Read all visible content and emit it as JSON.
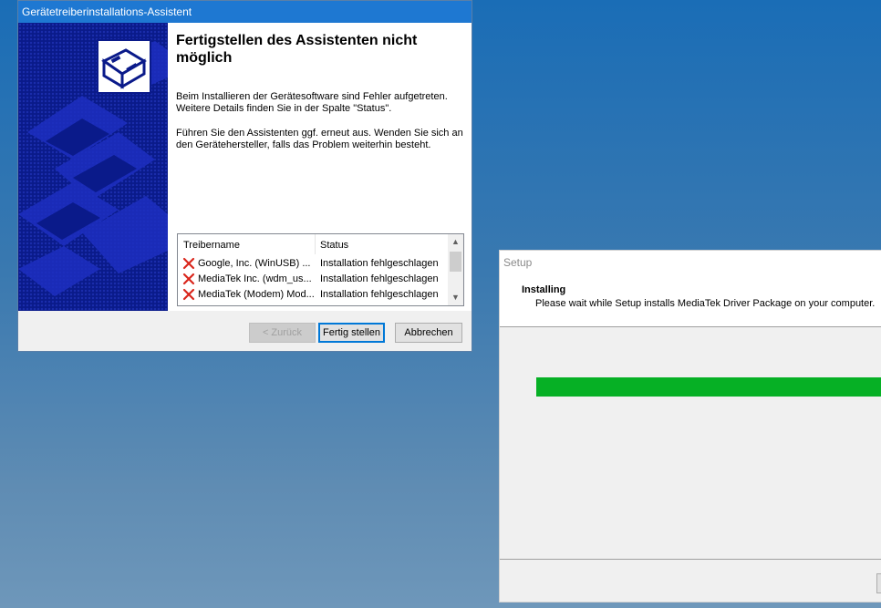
{
  "wizard": {
    "title": "Gerätetreiberinstallations-Assistent",
    "heading": "Fertigstellen des Assistenten nicht möglich",
    "paragraph1": "Beim Installieren der Gerätesoftware sind Fehler aufgetreten. Weitere Details finden Sie in der Spalte \"Status\".",
    "paragraph2": "Führen Sie den Assistenten ggf. erneut aus. Wenden Sie sich an den Gerätehersteller, falls das Problem weiterhin besteht.",
    "list": {
      "columns": [
        "Treibername",
        "Status"
      ],
      "rows": [
        {
          "name": "Google, Inc. (WinUSB) ...",
          "status": "Installation fehlgeschlagen"
        },
        {
          "name": "MediaTek Inc. (wdm_us...",
          "status": "Installation fehlgeschlagen"
        },
        {
          "name": "MediaTek (Modem) Mod...",
          "status": "Installation fehlgeschlagen"
        }
      ]
    },
    "buttons": {
      "back": "< Zurück",
      "finish": "Fertig stellen",
      "cancel": "Abbrechen"
    }
  },
  "setup": {
    "title": "Setup",
    "header_title": "Installing",
    "header_subtitle": "Please wait while Setup installs MediaTek Driver Package on your computer.",
    "progress_fraction": 1.0,
    "progress_color": "#06b025"
  },
  "icons": {
    "row_status_icon": "red-x-error-icon",
    "wizard_logo": "hardware-device-icon"
  }
}
